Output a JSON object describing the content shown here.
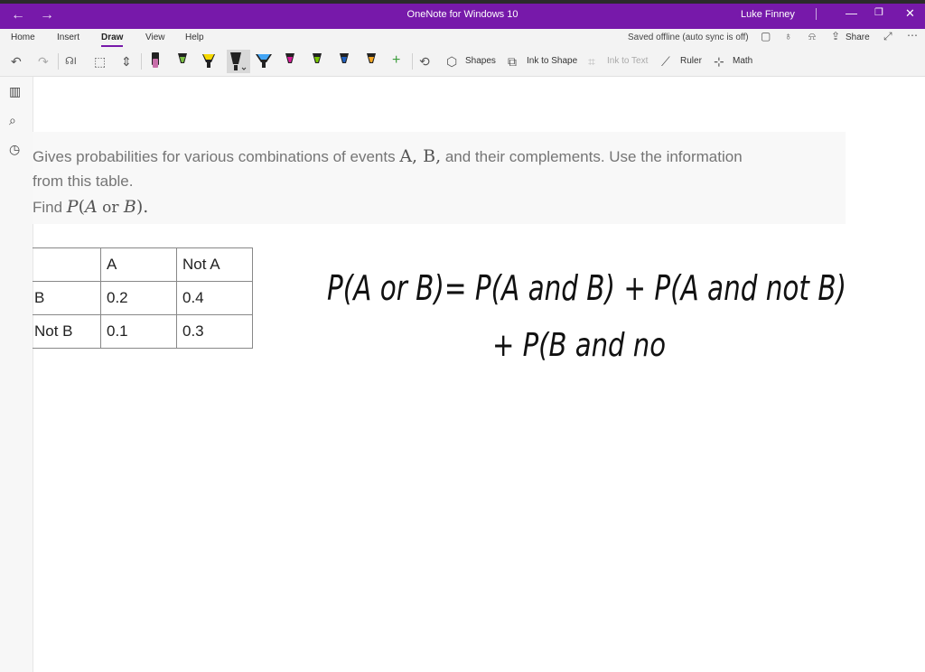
{
  "window": {
    "title": "OneNote for Windows 10",
    "user": "Luke Finney",
    "back_icon": "arrow-left-icon",
    "forward_icon": "arrow-right-icon",
    "minimize": "—",
    "restore": "❐",
    "close": "✕"
  },
  "menu": {
    "items": [
      "Home",
      "Insert",
      "Draw",
      "View",
      "Help"
    ],
    "active": "Draw",
    "status": "Saved offline (auto sync is off)",
    "share_label": "Share"
  },
  "toolbar": {
    "shapes_label": "Shapes",
    "ink_to_shape_label": "Ink to Shape",
    "ink_to_text_label": "Ink to Text",
    "ruler_label": "Ruler",
    "math_label": "Math",
    "pen_colors": [
      "#c76ea9",
      "#7bc043",
      "#f5d800",
      "#222222",
      "#42a5f5",
      "#d81b9a",
      "#78c800",
      "#1e5fbf",
      "#f5a623"
    ],
    "accent": "#7719aa"
  },
  "question": {
    "line1_a": "Gives probabilities for various combinations of events ",
    "line1_m": "A, B,",
    "line1_b": " and their complements. Use the information",
    "line2": "from this table.",
    "line3_a": "Find ",
    "line3_m1": "P",
    "line3_paren_open": "(",
    "line3_m2": "A",
    "line3_or": " or ",
    "line3_m3": "B",
    "line3_paren_close": ").",
    "table": {
      "header": [
        "",
        "A",
        "Not A"
      ],
      "rows": [
        [
          "B",
          "0.2",
          "0.4"
        ],
        [
          "Not B",
          "0.1",
          "0.3"
        ]
      ]
    }
  },
  "ink": {
    "line1": "P(A or B)= P(A and B) + P(A and not B)",
    "line2": "+ P(B and no"
  }
}
